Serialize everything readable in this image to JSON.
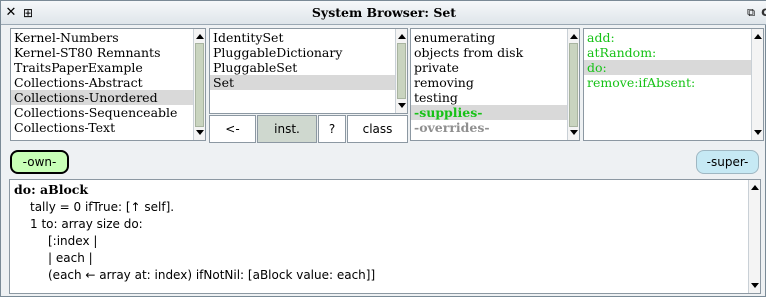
{
  "window": {
    "title": "System Browser: Set"
  },
  "categories": {
    "items": [
      {
        "label": "Kernel-Numbers",
        "selected": false
      },
      {
        "label": "Kernel-ST80 Remnants",
        "selected": false
      },
      {
        "label": "TraitsPaperExample",
        "selected": false
      },
      {
        "label": "Collections-Abstract",
        "selected": false
      },
      {
        "label": "Collections-Unordered",
        "selected": true
      },
      {
        "label": "Collections-Sequenceable",
        "selected": false
      },
      {
        "label": "Collections-Text",
        "selected": false
      }
    ]
  },
  "classes": {
    "items": [
      {
        "label": "IdentitySet",
        "selected": false
      },
      {
        "label": "PluggableDictionary",
        "selected": false
      },
      {
        "label": "PluggableSet",
        "selected": false
      },
      {
        "label": "Set",
        "selected": true
      }
    ]
  },
  "class_buttons": {
    "back": "<-",
    "inst": "inst.",
    "help": "?",
    "class": "class"
  },
  "protocols": {
    "items": [
      {
        "label": "enumerating"
      },
      {
        "label": "objects from disk"
      },
      {
        "label": "private"
      },
      {
        "label": "removing"
      },
      {
        "label": "testing"
      },
      {
        "label": "-supplies-"
      },
      {
        "label": "-overrides-"
      }
    ]
  },
  "methods": {
    "items": [
      {
        "label": "add:"
      },
      {
        "label": "atRandom:"
      },
      {
        "label": "do:"
      },
      {
        "label": "remove:ifAbsent:"
      }
    ]
  },
  "toolbar": {
    "own": "-own-",
    "super": "-super-"
  },
  "code": {
    "lines": [
      "do: aBlock",
      "tally = 0 ifTrue: [↑ self].",
      "1 to: array size do:",
      "[:index |",
      "| each |",
      "(each ← array at: index) ifNotNil: [aBlock value: each]]"
    ]
  },
  "colors": {
    "green_text": "#16c216",
    "own_button": "#c8ffb6",
    "super_button": "#c6e9f4",
    "selection": "#d9d9d9"
  },
  "icons": [
    "close-icon",
    "window-menu-icon",
    "collapse-icon"
  ]
}
